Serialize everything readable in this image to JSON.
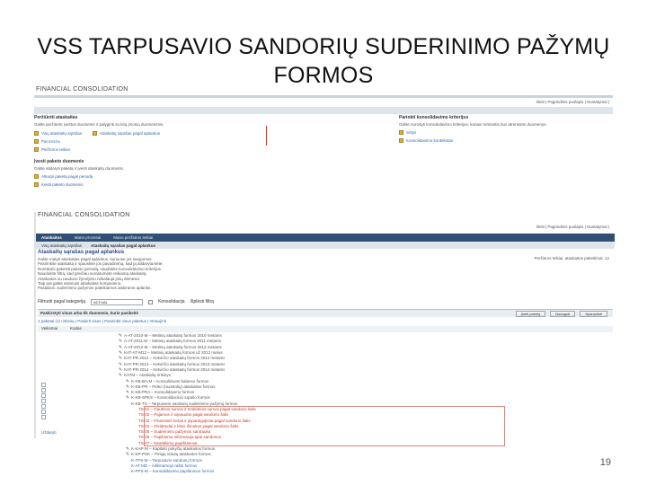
{
  "slide": {
    "title": "VSS TARPUSAVIO SANDORIŲ SUDERINIMO PAŽYMŲ FORMOS",
    "page_number": "19"
  },
  "shot1": {
    "app_title": "FINANCIAL CONSOLIDATION",
    "toplinks": "Išeiti | Pagrindinis puslapis | Nustatymai |",
    "panel1": {
      "heading": "Peržiūrėti ataskaitas",
      "text": "Galite peržiūrėti įvestus duomenis ir palyginti su kitų įmonių duomenimis.",
      "links": [
        "Visų ataskaitų sąrašas",
        "Ataskaitų sąrašas pagal aplankus",
        "Pat inscriu",
        "Peržiūros teikiai"
      ]
    },
    "panel2": {
      "heading": "Parinkti konsolidavimo kriterijus",
      "text": "Galite nurodyti konsolidavimo kriterijus, kuriais remiantis bus atrenkami duomenys.",
      "links": [
        "Sritys",
        "Konsolidavimo kontekstas"
      ]
    },
    "panel3": {
      "heading": "Įvesti paketo duomenis",
      "text": "Galite atidaryti paketą ir įvesti ataskaitų duomenis.",
      "links": [
        "Atkurpi paketą pagal periodą",
        "Keisti paketo duomenis"
      ]
    }
  },
  "shot2": {
    "app_title": "FINANCIAL CONSOLIDATION",
    "toplinks": "Išeiti | Pagrindinis puslapis | Nustatymai |",
    "tabs": [
      "Ataskaitos",
      "Mano procesai",
      "Mano peržiūros teikiai"
    ],
    "active_tab": 0,
    "subtabs": [
      "Visų ataskaitų sąrašas",
      "Ataskaitų sąrašas pagal aplankus"
    ],
    "form_heading": "Ataskaitų sąrašas pagal aplankus",
    "right_note": "Peržiūros teikiai, ataskaitos pakeitimai: 12",
    "instructions": [
      "Galite matyti ataskaitas pagal aplankus, kuriuose jos saugomos.",
      "Pasirinkite ataskaitą ir spauskite jos pavadinimą, kad ją atidarytumėte.",
      "Norėdami pakeisti paketo periodą, naudokite konsolidavimo kriterijus.",
      "Naudokite filtrą, kad greičiau surastumėte reikiamą ataskaitą.",
      "Ataskaitos su raudonu žymėjimu reikalauja jūsų dėmesio.",
      "Taip pat galite atsisiųsti ataskaitas kompiuteriu.",
      "Pastabos: suderinimo pažymos pateikiamos atskirame aplanke."
    ],
    "filter": {
      "label": "Filtruoti pagal kategoriją",
      "select_value": "ACTUAL",
      "checkbox_label": "Konsolidacija",
      "search_label": "Išplėsti filtrą"
    },
    "grid_heading": "Paskirstyti visus arba tik duomenis, kurie pasikeitė",
    "buttons": [
      "Įkelti paketą",
      "Išsaugoti",
      "Spausdinti"
    ],
    "summary": "1 paketai (1) rinkinių | Paskirti visus | Pasirinkti visus paketus | Atnaujinti",
    "columns": [
      "Veiksmai",
      "Kodas"
    ],
    "rows": [
      {
        "text": "A-AT-2010-M – Metinių ataskaitų formos 2010 metams",
        "style": "normal",
        "indent": 0,
        "pencil": true
      },
      {
        "text": "A-AT-2011-M – Metinių ataskaitų formos 2011 metams",
        "style": "normal",
        "indent": 0,
        "pencil": true
      },
      {
        "text": "A-AT-2012-M – Metinių ataskaitų formos 2012 metams",
        "style": "normal",
        "indent": 0,
        "pencil": true
      },
      {
        "text": "KAT-AT-M12 – Metinių ataskaitų formos už 2012 metus",
        "style": "normal",
        "indent": 0,
        "pencil": true
      },
      {
        "text": "KAT-PR-2012 – Ketvirčio ataskaitų formos 2012 metams",
        "style": "normal",
        "indent": 0,
        "pencil": true
      },
      {
        "text": "KAT-PR-2013 – Ketvirčio ataskaitų formos 2013 metams",
        "style": "normal",
        "indent": 0,
        "pencil": true
      },
      {
        "text": "KAT-PR-2014 – Ketvirčio ataskaitų formos 2014 metams",
        "style": "normal",
        "indent": 0,
        "pencil": true
      },
      {
        "text": "KATM – Ataskaitų rinkinys",
        "style": "normal",
        "indent": 0,
        "pencil": true
      },
      {
        "text": "K-KB-BA-M – Konsoliduoto balanso formos",
        "style": "normal",
        "indent": 1,
        "pencil": true
      },
      {
        "text": "K-KB-PR – Pelno (nuostolių) ataskaitos formos",
        "style": "normal",
        "indent": 1,
        "pencil": true
      },
      {
        "text": "K-KB-PRA – Konsolidavimo formos",
        "style": "normal",
        "indent": 1,
        "pencil": true
      },
      {
        "text": "K-KB-SPKS – Konsolidacinio sąrašo formos",
        "style": "normal",
        "indent": 1,
        "pencil": true
      },
      {
        "text": "K-KB-TS – Tarpusavio sandorių suderinimo pažymų formos",
        "style": "normal",
        "indent": 1,
        "pencil": false
      },
      {
        "text": "TS-01 – Gautinos sumos ir mokėtinos sumos pagal sandorio šalis",
        "style": "red",
        "indent": 2,
        "pencil": false
      },
      {
        "text": "TS-02 – Pajamos ir sąnaudos pagal sandorio šalis",
        "style": "red",
        "indent": 2,
        "pencil": false
      },
      {
        "text": "TS-03 – Finansinis turtas ir įsipareigojimai pagal sandorio šalis",
        "style": "red",
        "indent": 2,
        "pencil": false
      },
      {
        "text": "TS-04 – Dividendai ir kitos išmokos pagal sandorio šalis",
        "style": "red",
        "indent": 2,
        "pencil": false
      },
      {
        "text": "TS-05 – Suderinimo pažymos santrauka",
        "style": "red",
        "indent": 2,
        "pencil": false
      },
      {
        "text": "TS-06 – Papildoma informacija apie sandorius",
        "style": "red",
        "indent": 2,
        "pencil": false
      },
      {
        "text": "TS-07 – Neatitikimų paaiškinimai",
        "style": "red",
        "indent": 2,
        "pencil": false
      },
      {
        "text": "K-KAP-M – Kapitalo pokyčių ataskaitos formos",
        "style": "normal",
        "indent": 1,
        "pencil": true
      },
      {
        "text": "K-KP-PSK – Pinigų srautų ataskaitos formos",
        "style": "normal",
        "indent": 1,
        "pencil": true
      },
      {
        "text": "K-TPS-M – Tarpusavio sandorių formos",
        "style": "blue",
        "indent": 1,
        "pencil": false
      },
      {
        "text": "K-AT-MD – Aiškinamojo rašto formos",
        "style": "blue",
        "indent": 1,
        "pencil": false
      },
      {
        "text": "K-PPS-M – Konsolidavimo papildomos formos",
        "style": "blue",
        "indent": 1,
        "pencil": false
      }
    ],
    "footer": "Uždaryti"
  }
}
